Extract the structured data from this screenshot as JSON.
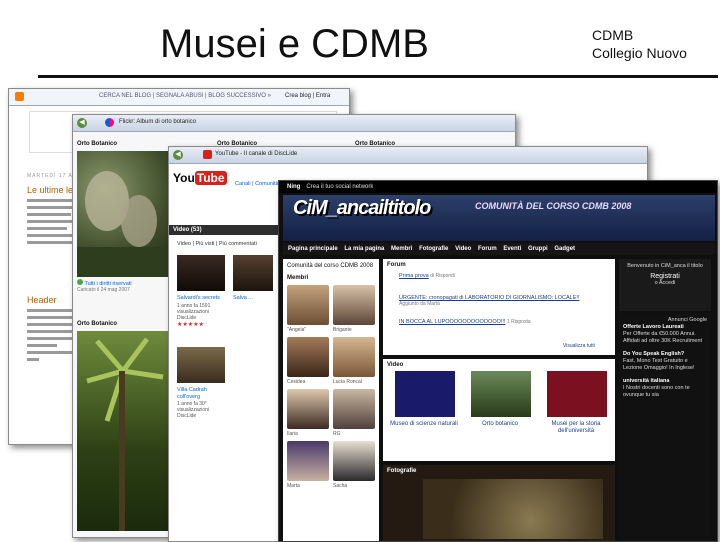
{
  "slide": {
    "title": "Musei e CDMB",
    "subtitle_line1": "CDMB",
    "subtitle_line2": "Collegio Nuovo"
  },
  "blogger": {
    "menu": "CERCA NEL BLOG | SEGNALA ABUSI | BLOG SUCCESSIVO »",
    "menu_right": "Crea blog | Entra",
    "date": "MARTEDÌ 17 APRILE",
    "heading1": "Le ultime le",
    "heading2": "Header"
  },
  "flickr": {
    "tab": "Flickr: Album di orto botanico",
    "col1": "Orto Botanico",
    "col2": "Orto Botanico",
    "col3": "Orto Botanico",
    "badge": "Tutti i diritti riservati",
    "meta": "Caricato il 24 mag 2007"
  },
  "youtube": {
    "tab": "YouTube - Il canale di DiscLide",
    "section": "Video (53)",
    "filters": "Video | Più visti | Più commentati",
    "nav": "Canali | Comunità",
    "videos": [
      {
        "title": "Salvardi's secrets",
        "meta": "1 anno fa 1591 visualizzazioni DiscLide"
      },
      {
        "title": "Salva ...",
        "meta": "1 anno fa DiscLide"
      },
      {
        "title": "Villa Cadrah coll'overg",
        "meta": "1 anno fa 30° visualizzazioni DiscLide"
      }
    ]
  },
  "ning": {
    "topbar": "Ning",
    "topbar_text": "Crea il tuo social network",
    "brand": "CiM_ancailtitolo",
    "tagline": "COMUNITÀ DEL CORSO CDMB 2008",
    "nav": [
      "Pagina principale",
      "La mia pagina",
      "Membri",
      "Fotografie",
      "Video",
      "Forum",
      "Eventi",
      "Gruppi",
      "Gadget"
    ],
    "community_title": "Comunità del corso CDMB 2008",
    "members_label": "Membri",
    "members": [
      "\"Angela\"",
      "Brigante",
      "Cesidea",
      "Lucia Roncal",
      "Ilaria",
      "RG",
      "Marta",
      "Sacha"
    ],
    "forum_label": "Forum",
    "forum": [
      {
        "title": "Prima prova",
        "sub": "di Rispondi"
      },
      {
        "title": "URGENTE: cronopagati di LABORATORIO DI GIORNALISMO: LOCALE!!",
        "sub": "Aggiunto da Marta"
      },
      {
        "title": "IN BOCCA AL LUPOOOOOOOOOOOOO!!!",
        "sub": "1 Risposta"
      }
    ],
    "video_label": "Video",
    "videos": [
      {
        "caption": "Museo di scienze naturali"
      },
      {
        "caption": "Orto botanico"
      },
      {
        "caption": "Musei per la storia dell'università"
      }
    ],
    "see_all": "Visualizza tutti",
    "photos_label": "Fotografie",
    "welcome": "Benvenuto in CiM_anca il titolo",
    "register": "Registrati",
    "login": "o Accedi",
    "ads_title": "Annunci Google",
    "ad1_title": "Offerte Lavoro Laureati",
    "ad1_text": "Per Offerte da €50.000 Annui. Affidati ad oltre 30K Recruitment",
    "ad2_title": "Do You Speak English?",
    "ad2_text": "Fast, Mono Test Gratuito e Lezione Omaggio! In Inglese!",
    "ad3_title": "università italiana",
    "ad3_text": "I Nostri docenti sono con te ovunque tu sia"
  }
}
